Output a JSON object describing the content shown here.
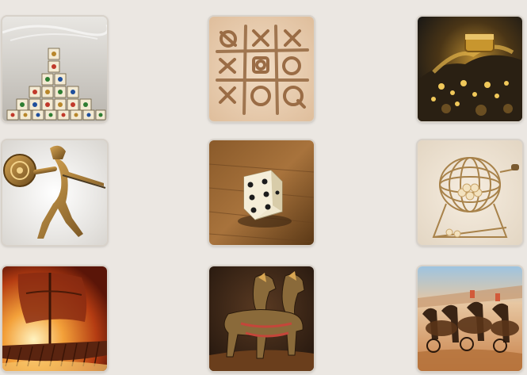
{
  "games": [
    {
      "id": "mahjong-pyramid",
      "icon": "mahjong-tiles-pyramid"
    },
    {
      "id": "tic-tac-toe",
      "icon": "tic-tac-toe-sand"
    },
    {
      "id": "treasure-hoard",
      "icon": "gold-treasure-pile"
    },
    {
      "id": "spartan-warrior",
      "icon": "bronze-spartan-statue"
    },
    {
      "id": "dice",
      "icon": "single-die"
    },
    {
      "id": "lottery-cage",
      "icon": "bingo-wire-cage"
    },
    {
      "id": "war-galley",
      "icon": "burning-ship"
    },
    {
      "id": "horse-team",
      "icon": "galloping-horses"
    },
    {
      "id": "chariot-race",
      "icon": "chariot-race-arena"
    }
  ]
}
